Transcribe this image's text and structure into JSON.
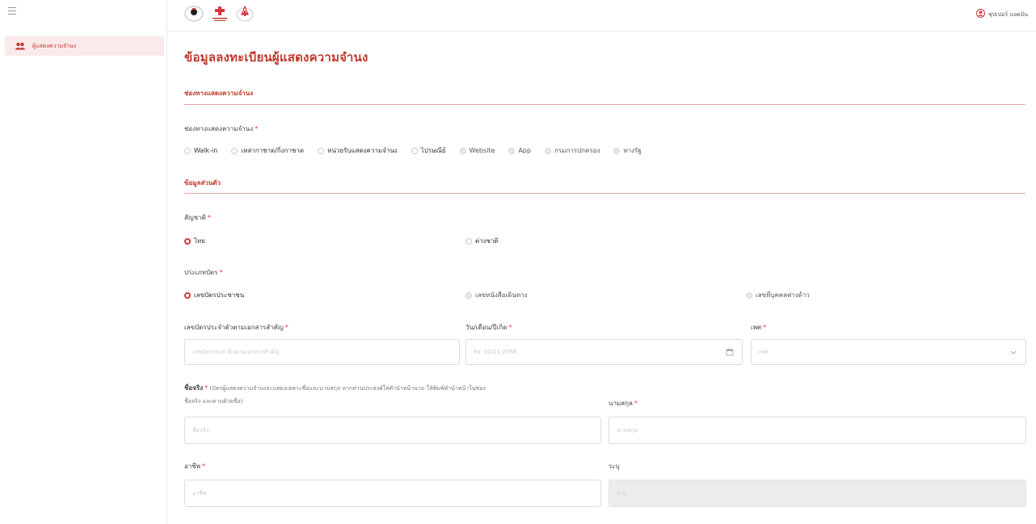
{
  "sidebar": {
    "items": [
      {
        "label": "ผู้แสดงความจำนง",
        "icon": "users-icon",
        "active": true
      }
    ]
  },
  "header": {
    "user_name": "ซุปเปอร์ แอดมิน",
    "user_icon": "user-circle-icon"
  },
  "page": {
    "title": "ข้อมูลลงทะเบียนผู้แสดงความจำนง"
  },
  "section_channel": {
    "title": "ช่องทางแสดงความจำนง",
    "field_label": "ช่องทางแสดงความจำนง",
    "options": [
      "Walk-in",
      "เหล่ากาชาด/กิ่งกาชาด",
      "หน่วยรับแสดงความจำนง",
      "ไปรษณีย์",
      "Website",
      "App",
      "กรมการปกครอง",
      "ทางรัฐ"
    ]
  },
  "section_personal": {
    "title": "ข้อมูลส่วนตัว",
    "nationality": {
      "label": "สัญชาติ",
      "options": [
        "ไทย",
        "ต่างชาติ"
      ],
      "selected": "ไทย"
    },
    "card_type": {
      "label": "ประเภทบัตร",
      "options": [
        "เลขบัตรประชาชน",
        "เลขหนังสือเดินทาง",
        "เลขที่บุคคลต่างด้าว"
      ],
      "selected": "เลขบัตรประชาชน"
    },
    "id_number": {
      "label": "เลขบัตรประจำตัวตามเอกสารสำคัญ",
      "placeholder": "เลขบัตรประจำตัวตามเอกสารสำคัญ"
    },
    "birth_date": {
      "label": "วัน/เดือน/ปีเกิด",
      "placeholder": "Ex. 01/11/2566"
    },
    "gender": {
      "label": "เพศ",
      "placeholder": "เพศ"
    },
    "first_name": {
      "label": "ชื่อจริง",
      "hint": "(บัตรผู้แสดงความจำนงจะแสดงเฉพาะชื่อและนามสกุล หากท่านประสงค์ใส่คำนำหน้านาม ให้พิมพ์คำนำหน้าในช่อง",
      "hint2": "ชื่อจริง และตามด้วยชื่อ)",
      "placeholder": "ชื่อจริง"
    },
    "last_name": {
      "label": "นามสกุล",
      "placeholder": "นามสกุล"
    },
    "occupation": {
      "label": "อาชีพ",
      "placeholder": "อาชีพ"
    },
    "specify": {
      "label": "ระบุ",
      "placeholder": "ระบุ"
    }
  },
  "colors": {
    "accent": "#c0392b",
    "required": "#d9363e",
    "sidebar_active_bg": "#fbeaea"
  }
}
